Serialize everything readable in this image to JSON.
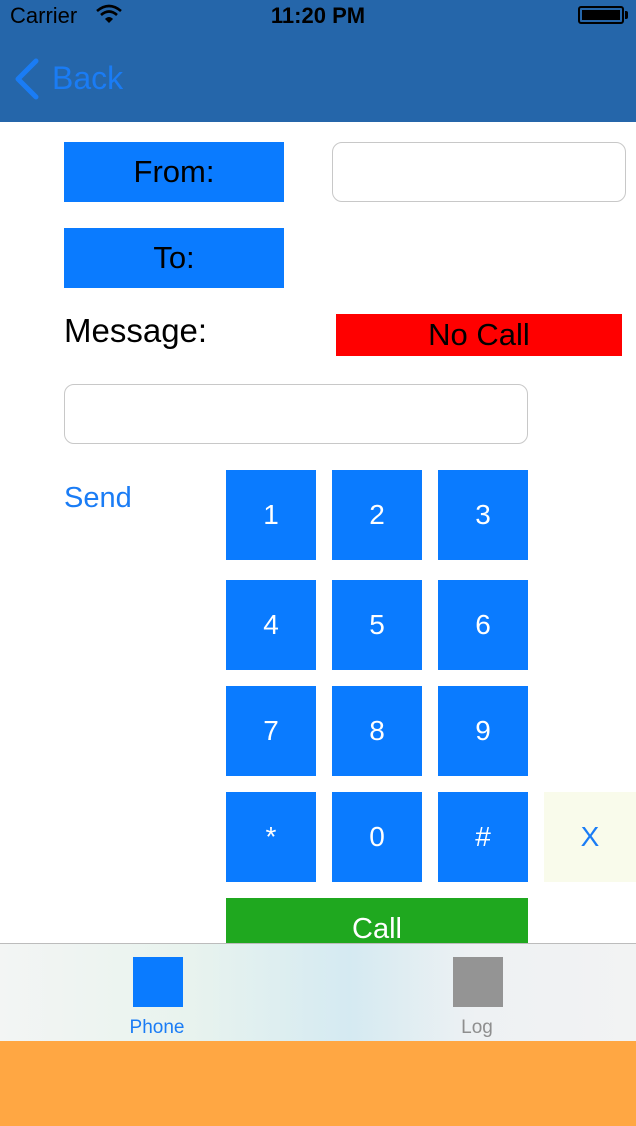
{
  "status_bar": {
    "carrier": "Carrier",
    "time": "11:20 PM"
  },
  "nav": {
    "back_label": "Back"
  },
  "form": {
    "from_label": "From:",
    "to_label": "To:",
    "message_label": "Message:",
    "call_status": "No Call",
    "from_value": "",
    "message_value": "",
    "send_label": "Send"
  },
  "keypad": {
    "keys": [
      "1",
      "2",
      "3",
      "4",
      "5",
      "6",
      "7",
      "8",
      "9",
      "*",
      "0",
      "#"
    ],
    "clear_label": "X",
    "call_label": "Call"
  },
  "tabs": {
    "phone_label": "Phone",
    "log_label": "Log"
  },
  "colors": {
    "nav": "#2566aa",
    "accent": "#0a7bff",
    "status_no_call": "#ff0000",
    "call": "#1fa81f",
    "bottom": "#ffa743"
  }
}
